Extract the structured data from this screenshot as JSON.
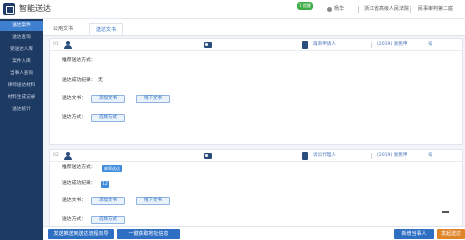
{
  "header": {
    "app_title": "智能送达",
    "notice_badge": "1 提醒",
    "user": "杨华",
    "court": "浙江省高级人民法院",
    "dept": "民事审判第二庭"
  },
  "sidebar": {
    "items": [
      {
        "label": "送达案件"
      },
      {
        "label": "送达查询"
      },
      {
        "label": "受送达人库"
      },
      {
        "label": "案件入库"
      },
      {
        "label": "当事人查询"
      },
      {
        "label": "律师送达材料"
      },
      {
        "label": "材料生成记录"
      },
      {
        "label": "送达统计"
      }
    ]
  },
  "tabs": [
    {
      "label": "公用文书"
    },
    {
      "label": "送达文书"
    }
  ],
  "panels": [
    {
      "num": "01",
      "role": "再审申请人",
      "case_number": "(2019) 浙民申",
      "case_suffix": "号",
      "labels": {
        "recommended": "推荐送达方式：",
        "success": "送达成功纪录：",
        "docs": "送达文书：",
        "method": "送达方式："
      },
      "success_value": "无",
      "recommended_tag": "",
      "buttons": {
        "online": "添加文书",
        "offline": "线下文书",
        "method": "选择方式"
      }
    },
    {
      "num": "02",
      "role": "诉讼代理人",
      "case_number": "(2019) 浙民申",
      "case_suffix": "号",
      "labels": {
        "recommended": "推荐送达方式：",
        "success": "送达成功纪录：",
        "docs": "送达文书：",
        "method": "送达方式："
      },
      "success_value": "12",
      "recommended_tag": "邮寄送达",
      "buttons": {
        "online": "添加文书",
        "offline": "线下文书",
        "method": "选择方式"
      }
    }
  ],
  "footer": {
    "btn_push": "发送推送到送达流程向导",
    "btn_address": "一键获取地址信息",
    "btn_add_party": "新增当事人",
    "btn_send": "发起送达"
  }
}
